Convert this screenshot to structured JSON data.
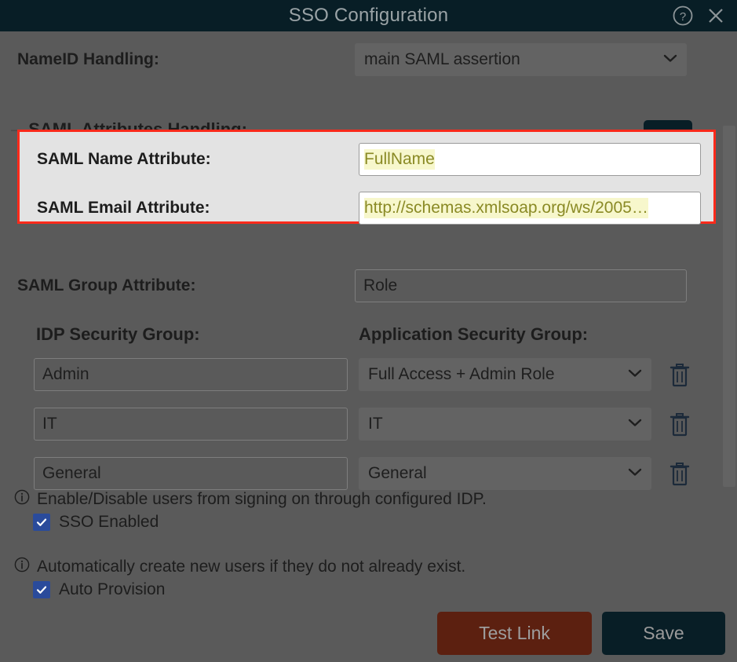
{
  "window": {
    "title": "SSO Configuration",
    "help_icon": "help-circle-icon",
    "close_icon": "close-icon"
  },
  "nameid": {
    "label": "NameID Handling:",
    "value": "main SAML assertion",
    "options": [
      "main SAML assertion"
    ]
  },
  "attributes_section": {
    "collapse_toggle": "–",
    "title": "SAML Attributes Handling:",
    "add_button_label": "+",
    "highlight_color": "#fb2a1b",
    "rows": [
      {
        "label": "SAML Name Attribute:",
        "value": "FullName"
      },
      {
        "label": "SAML Email Attribute:",
        "value": "http://schemas.xmlsoap.org/ws/2005…"
      }
    ]
  },
  "group_attribute": {
    "label": "SAML Group Attribute:",
    "value": "Role"
  },
  "group_mapping": {
    "idp_header": "IDP Security Group:",
    "app_header": "Application Security Group:",
    "rows": [
      {
        "idp": "Admin",
        "app": "Full Access + Admin Role",
        "delete_icon": "trash-icon"
      },
      {
        "idp": "IT",
        "app": "IT",
        "delete_icon": "trash-icon"
      },
      {
        "idp": "General",
        "app": "General",
        "delete_icon": "trash-icon"
      }
    ]
  },
  "toggles": [
    {
      "info_icon": "info-circle-icon",
      "description": "Enable/Disable users from signing on through configured IDP.",
      "checkbox_label": "SSO Enabled",
      "checked": true
    },
    {
      "info_icon": "info-circle-icon",
      "description": "Automatically create new users if they do not already exist.",
      "checkbox_label": "Auto Provision",
      "checked": true
    }
  ],
  "footer": {
    "test_link_label": "Test Link",
    "test_link_color": "#5c2010",
    "save_label": "Save",
    "save_color": "#081e26"
  }
}
